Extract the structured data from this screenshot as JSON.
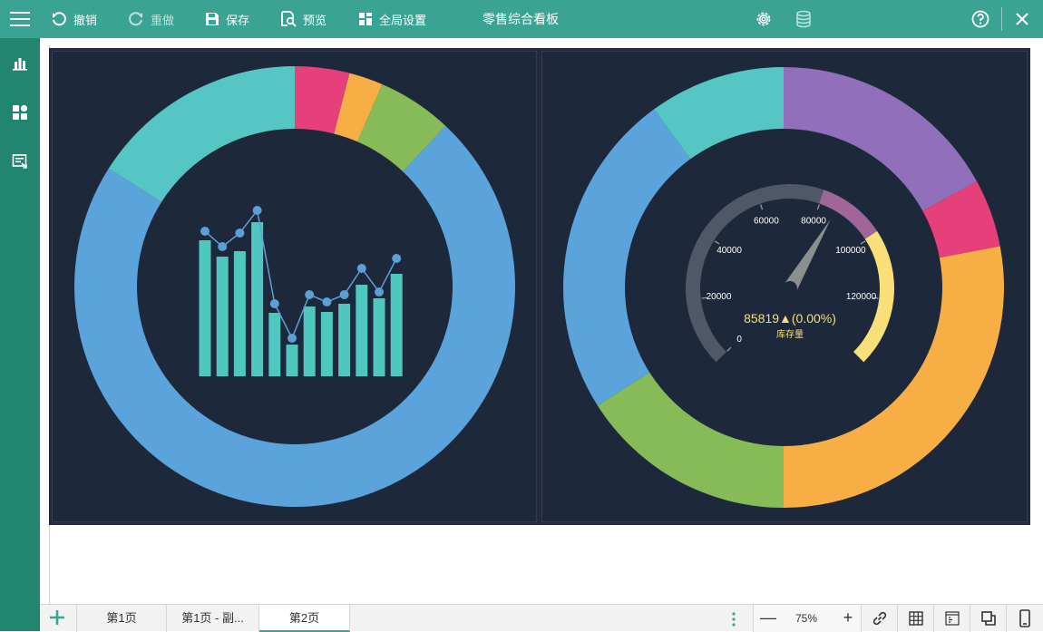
{
  "toolbar": {
    "undo_label": "撤销",
    "redo_label": "重做",
    "save_label": "保存",
    "preview_label": "预览",
    "global_settings_label": "全局设置",
    "title": "零售综合看板",
    "icons": [
      "menu-icon",
      "undo-icon",
      "redo-icon",
      "save-icon",
      "preview-icon",
      "grid-settings-icon",
      "gear-icon",
      "database-icon",
      "help-icon",
      "close-icon"
    ]
  },
  "sidebar": {
    "items": [
      {
        "name": "chart-icon"
      },
      {
        "name": "components-icon"
      },
      {
        "name": "form-icon"
      }
    ]
  },
  "colors": {
    "topbar": "#3aa394",
    "sidebar": "#22856f",
    "dashboard_bg": "#1e283b",
    "blue": "#5ba3db",
    "cyan": "#55c6c3",
    "pink": "#e6407a",
    "orange": "#f7ae44",
    "green": "#86bb57",
    "purple": "#926fbb",
    "gauge_yellow": "#f8df78",
    "gauge_mauve": "#a06699",
    "gauge_track": "#505868",
    "bar_color": "#4fc6be",
    "line_color": "#5aa0d6"
  },
  "chart_data": [
    {
      "type": "pie",
      "variant": "donut",
      "slices": [
        {
          "value": 4.0,
          "color": "#e6407a"
        },
        {
          "value": 2.5,
          "color": "#f7ae44"
        },
        {
          "value": 5.5,
          "color": "#86bb57"
        },
        {
          "value": 72.0,
          "color": "#5ba3db"
        },
        {
          "value": 16.0,
          "color": "#55c6c3"
        }
      ]
    },
    {
      "type": "bar",
      "combo_line": true,
      "bars": [
        150,
        132,
        138,
        170,
        70,
        35,
        77,
        71,
        80,
        101,
        86,
        113
      ],
      "line": [
        160,
        143,
        158,
        183,
        80,
        42,
        90,
        82,
        90,
        119,
        93,
        130
      ],
      "bar_color": "#4fc6be",
      "line_color": "#5aa0d6"
    },
    {
      "type": "pie",
      "variant": "donut",
      "slices": [
        {
          "value": 17.0,
          "color": "#926fbb"
        },
        {
          "value": 5.0,
          "color": "#e6407a"
        },
        {
          "value": 28.0,
          "color": "#f7ae44"
        },
        {
          "value": 16.0,
          "color": "#86bb57"
        },
        {
          "value": 24.0,
          "color": "#5ba3db"
        },
        {
          "value": 10.0,
          "color": "#55c6c3"
        }
      ]
    },
    {
      "type": "gauge",
      "value": 85819,
      "min": 0,
      "max": 140000,
      "ticks": [
        "0",
        "20000",
        "40000",
        "60000",
        "80000",
        "100000",
        "120000"
      ],
      "value_label": "85819▲(0.00%)",
      "name": "库存量",
      "bands": [
        {
          "to": 0.57,
          "color": "#505868"
        },
        {
          "to": 0.71,
          "color": "#a06699"
        },
        {
          "to": 1.0,
          "color": "#f8df78"
        }
      ]
    }
  ],
  "pages": {
    "tabs": [
      {
        "label": "第1页",
        "active": false
      },
      {
        "label": "第1页 - 副...",
        "active": false
      },
      {
        "label": "第2页",
        "active": true
      }
    ]
  },
  "zoom": {
    "minus": "—",
    "label": "75%",
    "plus": "+"
  },
  "bottom_icons": [
    "link-icon",
    "table-grid-icon",
    "ruler-icon",
    "layers-icon",
    "mobile-icon"
  ]
}
